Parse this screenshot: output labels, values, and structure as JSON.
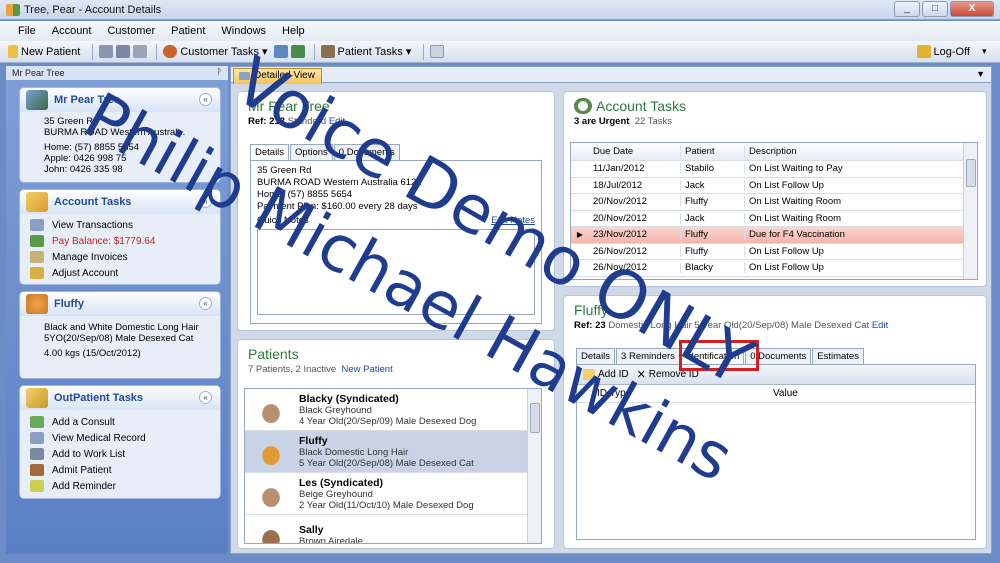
{
  "window": {
    "title": "Tree, Pear - Account Details",
    "buttons": [
      "_",
      "□",
      "X"
    ]
  },
  "menu": [
    "File",
    "Account",
    "Customer",
    "Patient",
    "Windows",
    "Help"
  ],
  "toolbar": {
    "new_patient": "New Patient",
    "customer_tasks": "Customer Tasks ▾",
    "patient_tasks": "Patient Tasks ▾",
    "logoff": "Log-Off"
  },
  "left": {
    "header": "Mr Pear Tree",
    "pin": "ᚹ",
    "customer": {
      "name": "Mr Pear Tree",
      "lines": [
        "35 Green Rd",
        "BURMA ROAD Western Austral...",
        "Home: (57) 8855 5654",
        "Apple: 0426 998 75",
        "John: 0426 335 98"
      ]
    },
    "account_tasks": {
      "title": "Account Tasks",
      "items": [
        "View Transactions",
        "Pay Balance: $1779.64",
        "Manage Invoices",
        "Adjust Account"
      ]
    },
    "fluffy": {
      "title": "Fluffy",
      "desc": "Black and White Domestic Long Hair 5YO(20/Sep/08) Male Desexed Cat",
      "weight": "4.00 kgs (15/Oct/2012)"
    },
    "outpatient": {
      "title": "OutPatient Tasks",
      "items": [
        "Add a Consult",
        "View Medical Record",
        "Add to Work List",
        "Admit Patient",
        "Add Reminder"
      ]
    },
    "collapse": "«"
  },
  "main": {
    "tab": "Detailed View",
    "dropdown": "▼",
    "customer": {
      "name": "Mr Pear Tree",
      "ref_label": "Ref: 213",
      "ref_rest": " Standard",
      "edit": "Edit",
      "tabs": [
        "Details",
        "Options",
        "0 Documents"
      ],
      "address1": "35 Green Rd",
      "address2": "BURMA ROAD Western Australia 6122",
      "home": "Home: (57) 8855 5654",
      "plan": "Payment Plan: $160.00 every 28 days",
      "quick_notes": "Quick Notes",
      "edit_notes": "Edit Notes"
    },
    "account_tasks": {
      "title": "Account Tasks",
      "urgent": "3 are Urgent",
      "count": "22 Tasks",
      "headers": [
        "Due Date",
        "Patient",
        "Description"
      ],
      "rows": [
        {
          "marker": "",
          "date": "11/Jan/2012",
          "patient": "Stabilo",
          "desc": "On List Waiting to Pay"
        },
        {
          "marker": "",
          "date": "18/Jul/2012",
          "patient": "Jack",
          "desc": "On List Follow Up"
        },
        {
          "marker": "",
          "date": "20/Nov/2012",
          "patient": "Fluffy",
          "desc": "On List Waiting Room"
        },
        {
          "marker": "",
          "date": "20/Nov/2012",
          "patient": "Jack",
          "desc": "On List Waiting Room"
        },
        {
          "marker": "▶",
          "date": "23/Nov/2012",
          "patient": "Fluffy",
          "desc": "Due for F4 Vaccination"
        },
        {
          "marker": "",
          "date": "26/Nov/2012",
          "patient": "Fluffy",
          "desc": "On List Follow Up"
        },
        {
          "marker": "",
          "date": "26/Nov/2012",
          "patient": "Blacky",
          "desc": "On List Follow Up"
        }
      ]
    },
    "patients": {
      "title": "Patients",
      "summary": "7 Patients, 2 Inactive",
      "new": "New Patient",
      "list": [
        {
          "name": "Blacky (Syndicated)",
          "breed": "Black Greyhound",
          "info": "4 Year Old(20/Sep/09) Male Desexed Dog"
        },
        {
          "name": "Fluffy",
          "breed": "Black Domestic Long Hair",
          "info": "5 Year Old(20/Sep/08) Male Desexed Cat"
        },
        {
          "name": "Les (Syndicated)",
          "breed": "Beige Greyhound",
          "info": "2 Year Old(11/Oct/10) Male Desexed Dog"
        },
        {
          "name": "Sally",
          "breed": "Brown Airedale",
          "info": ""
        }
      ]
    },
    "patient_detail": {
      "name": "Fluffy",
      "ref_label": "Ref: 23",
      "ref_rest": " Domestic Long Hair 5 Year Old(20/Sep/08) Male Desexed Cat",
      "edit": "Edit",
      "tabs": [
        "Details",
        "3 Reminders",
        "Identification",
        "0 Documents",
        "Estimates"
      ],
      "add_id": "Add ID",
      "remove_id": "Remove ID",
      "col1": "ID Type",
      "col2": "Value"
    }
  },
  "watermark": {
    "line1": "Voice Demo ONLY",
    "line2": "Philip Michael Hawkins",
    "color": "#1f3c8f"
  }
}
